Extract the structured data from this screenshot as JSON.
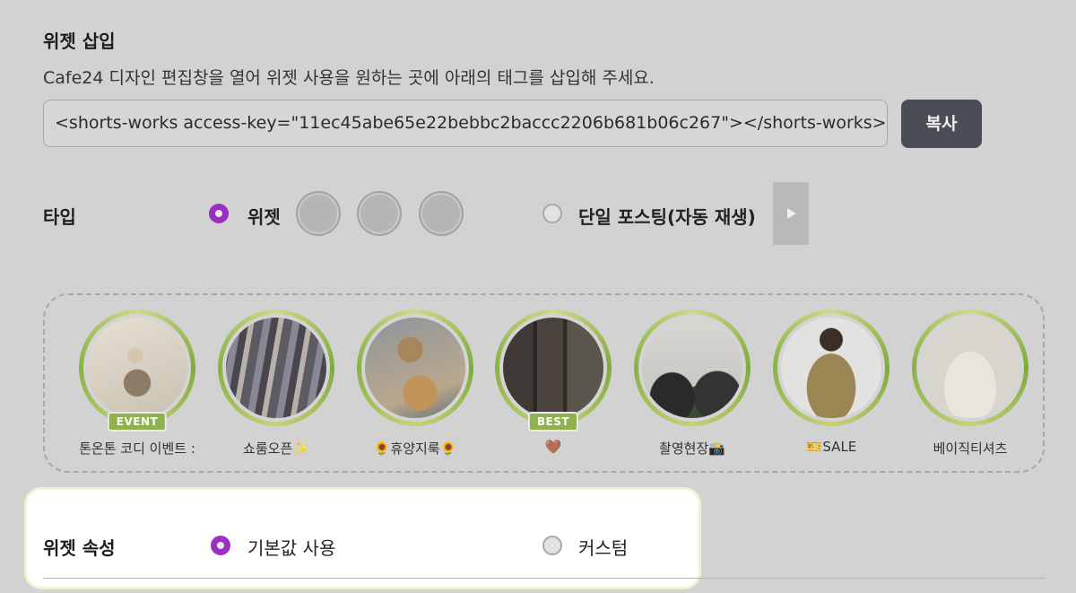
{
  "widget_insert": {
    "title": "위젯 삽입",
    "description": "Cafe24 디자인 편집창을 열어 위젯 사용을 원하는 곳에 아래의 태그를 삽입해 주세요.",
    "code": "<shorts-works access-key=\"11ec45abe65e22bebbc2baccc2206b681b06c267\"></shorts-works>",
    "copy_label": "복사"
  },
  "type_row": {
    "label": "타입",
    "option_widget": "위젯",
    "option_single": "단일 포스팅(자동 재생)",
    "selected": "위젯",
    "swatch_colors": [
      "#b5b5b5",
      "#b5b5b5",
      "#b5b5b5"
    ],
    "play_icon": "play-icon"
  },
  "stories": [
    {
      "label": "톤온톤 코디 이벤트 :",
      "badge": "EVENT"
    },
    {
      "label": "쇼룸오픈✨",
      "badge": ""
    },
    {
      "label": "🌻휴양지룩🌻",
      "badge": ""
    },
    {
      "label": "🤎",
      "badge": "BEST"
    },
    {
      "label": "촬영현장📸",
      "badge": ""
    },
    {
      "label": "🎫SALE",
      "badge": ""
    },
    {
      "label": "베이직티셔츠",
      "badge": ""
    }
  ],
  "widget_props": {
    "label": "위젯 속성",
    "option_default": "기본값 사용",
    "option_custom": "커스텀",
    "selected": "기본값 사용"
  },
  "colors": {
    "accent_radio": "#9b2fc4",
    "badge_green": "#8fb24e",
    "copy_button": "#4a4d53"
  }
}
